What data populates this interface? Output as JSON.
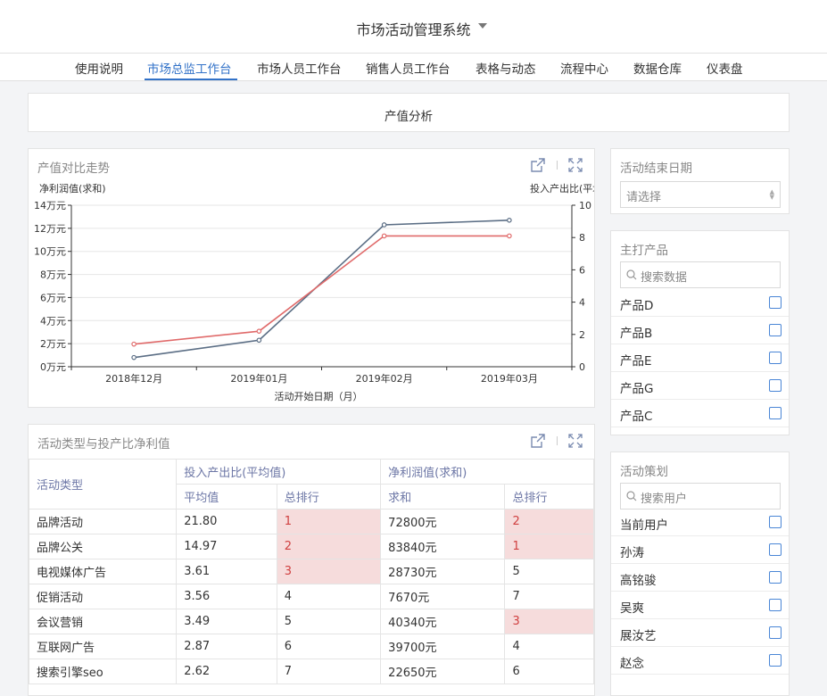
{
  "app": {
    "title": "市场活动管理系统"
  },
  "nav": {
    "items": [
      {
        "label": "使用说明"
      },
      {
        "label": "市场总监工作台"
      },
      {
        "label": "市场人员工作台"
      },
      {
        "label": "销售人员工作台"
      },
      {
        "label": "表格与动态"
      },
      {
        "label": "流程中心"
      },
      {
        "label": "数据仓库"
      },
      {
        "label": "仪表盘"
      }
    ],
    "active_index": 1
  },
  "header_panel": {
    "title": "产值分析"
  },
  "chart_panel": {
    "title": "产值对比走势"
  },
  "chart_data": {
    "type": "line",
    "x": [
      "2018年12月",
      "2019年01月",
      "2019年02月",
      "2019年03月"
    ],
    "xlabel": "活动开始日期（月）",
    "ylabel_left": "净利润值(求和)",
    "ylabel_right": "投入产出比(平均",
    "y_left_ticks": [
      "0万元",
      "2万元",
      "4万元",
      "6万元",
      "8万元",
      "10万元",
      "12万元",
      "14万元"
    ],
    "y_left_range": [
      0,
      14
    ],
    "y_right_ticks": [
      "0",
      "2",
      "4",
      "6",
      "8",
      "10"
    ],
    "y_right_range": [
      0,
      10
    ],
    "series": [
      {
        "name": "净利润值(求和)",
        "axis": "left",
        "color": "#5b6e85",
        "values": [
          0.8,
          2.3,
          12.3,
          12.7
        ]
      },
      {
        "name": "投入产出比(平均值)",
        "axis": "right",
        "color": "#e06a6a",
        "values": [
          1.4,
          2.2,
          8.1,
          8.1
        ]
      }
    ]
  },
  "table_panel": {
    "title": "活动类型与投产比净利值",
    "headers": {
      "type": "活动类型",
      "group1": "投入产出比(平均值)",
      "group2": "净利润值(求和)",
      "avg": "平均值",
      "rank1": "总排行",
      "sum": "求和",
      "rank2": "总排行"
    },
    "rows": [
      {
        "type": "品牌活动",
        "avg": "21.80",
        "rank1": "1",
        "sum": "72800元",
        "rank2": "2"
      },
      {
        "type": "品牌公关",
        "avg": "14.97",
        "rank1": "2",
        "sum": "83840元",
        "rank2": "1"
      },
      {
        "type": "电视媒体广告",
        "avg": "3.61",
        "rank1": "3",
        "sum": "28730元",
        "rank2": "5"
      },
      {
        "type": "促销活动",
        "avg": "3.56",
        "rank1": "4",
        "sum": "7670元",
        "rank2": "7"
      },
      {
        "type": "会议营销",
        "avg": "3.49",
        "rank1": "5",
        "sum": "40340元",
        "rank2": "3"
      },
      {
        "type": "互联网广告",
        "avg": "2.87",
        "rank1": "6",
        "sum": "39700元",
        "rank2": "4"
      },
      {
        "type": "搜索引擎seo",
        "avg": "2.62",
        "rank1": "7",
        "sum": "22650元",
        "rank2": "6"
      }
    ]
  },
  "filter_date": {
    "title": "活动结束日期",
    "placeholder": "请选择"
  },
  "filter_product": {
    "title": "主打产品",
    "search_placeholder": "搜索数据",
    "items": [
      "产品D",
      "产品B",
      "产品E",
      "产品G",
      "产品C"
    ]
  },
  "filter_planner": {
    "title": "活动策划",
    "search_placeholder": "搜索用户",
    "items": [
      "当前用户",
      "孙涛",
      "高铭骏",
      "吴爽",
      "展汝艺",
      "赵念"
    ]
  },
  "colors": {
    "accent": "#3272c8",
    "highlight_bg": "#f6dcdc",
    "highlight_text": "#d04040"
  }
}
